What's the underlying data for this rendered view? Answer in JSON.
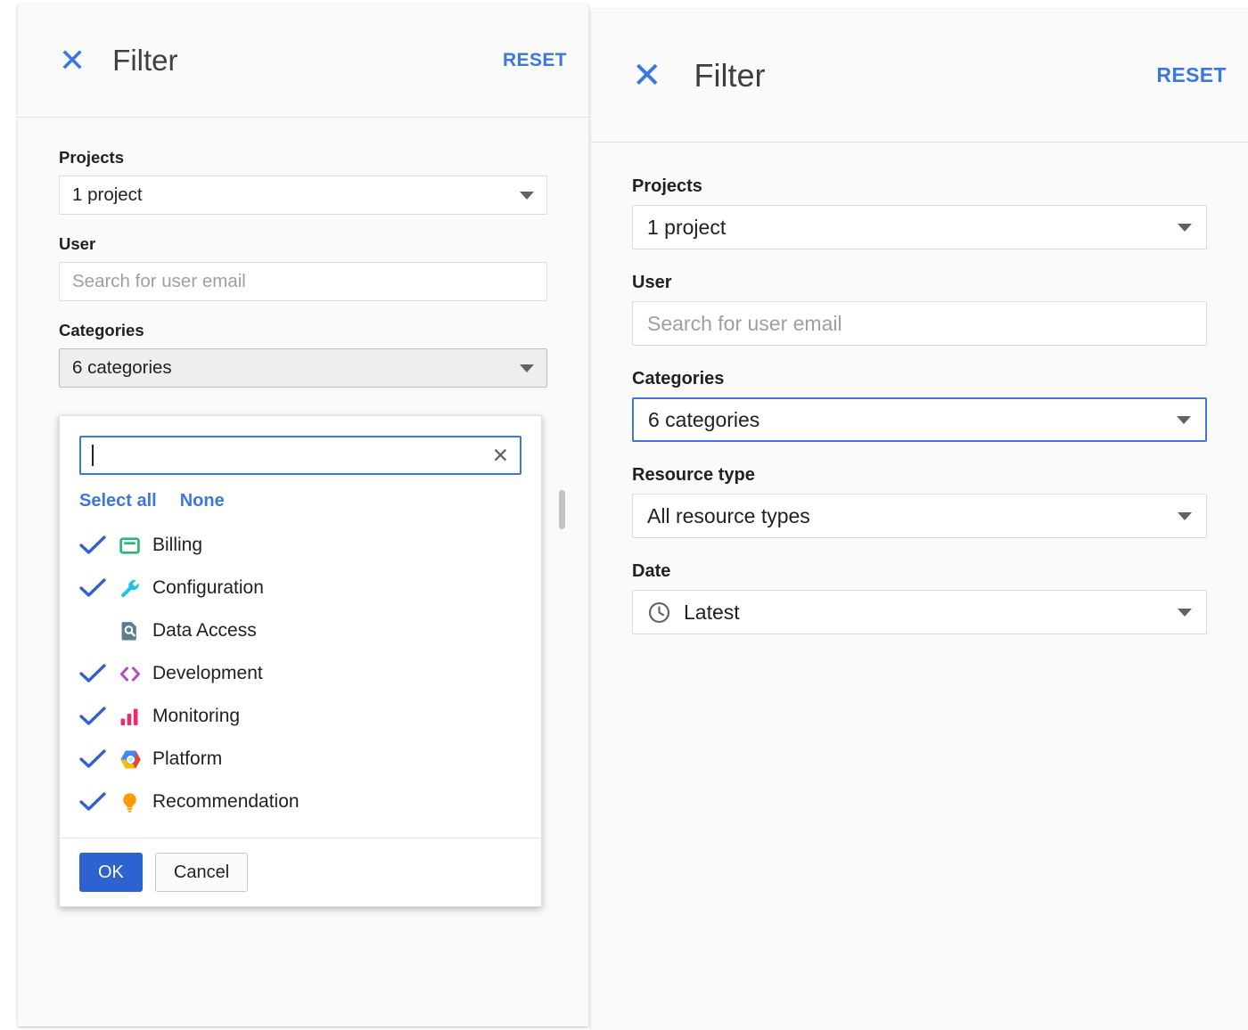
{
  "colors": {
    "accent_blue": "#3b77e3",
    "button_blue": "#2d62d0",
    "billing_green": "#2ab673",
    "configuration_cyan": "#22c3e6",
    "data_access_slate": "#5b7d8c",
    "development_purple": "#b14ec4",
    "monitoring_pink": "#ef2c6b",
    "recommendation_orange": "#fb9b00",
    "text_primary": "#202124",
    "text_placeholder": "#9aa0a6",
    "border": "#dadce0",
    "panel_bg": "#fafafa"
  },
  "left_panel": {
    "header": {
      "close_icon": "close-icon",
      "title": "Filter",
      "reset_label": "RESET"
    },
    "fields": {
      "projects": {
        "label": "Projects",
        "value": "1 project"
      },
      "user": {
        "label": "User",
        "value": "",
        "placeholder": "Search for user email"
      },
      "categories": {
        "label": "Categories",
        "value": "6 categories"
      }
    },
    "dropdown": {
      "search": {
        "value": "",
        "placeholder": "",
        "clear_icon": "clear-x-icon"
      },
      "select_all_label": "Select all",
      "none_label": "None",
      "items": [
        {
          "label": "Billing",
          "checked": true,
          "icon": "credit-card-icon"
        },
        {
          "label": "Configuration",
          "checked": true,
          "icon": "wrench-icon"
        },
        {
          "label": "Data Access",
          "checked": false,
          "icon": "document-search-icon"
        },
        {
          "label": "Development",
          "checked": true,
          "icon": "code-brackets-icon"
        },
        {
          "label": "Monitoring",
          "checked": true,
          "icon": "bar-chart-icon"
        },
        {
          "label": "Platform",
          "checked": true,
          "icon": "cloud-hexagon-icon"
        },
        {
          "label": "Recommendation",
          "checked": true,
          "icon": "lightbulb-icon"
        }
      ],
      "ok_label": "OK",
      "cancel_label": "Cancel"
    }
  },
  "right_panel": {
    "header": {
      "close_icon": "close-icon",
      "title": "Filter",
      "reset_label": "RESET"
    },
    "fields": {
      "projects": {
        "label": "Projects",
        "value": "1 project"
      },
      "user": {
        "label": "User",
        "value": "",
        "placeholder": "Search for user email"
      },
      "categories": {
        "label": "Categories",
        "value": "6 categories"
      },
      "resource_type": {
        "label": "Resource type",
        "value": "All resource types"
      },
      "date": {
        "label": "Date",
        "value": "Latest",
        "icon": "clock-icon"
      }
    }
  }
}
